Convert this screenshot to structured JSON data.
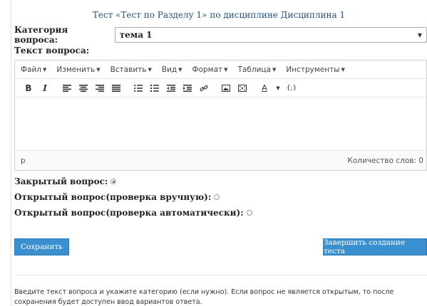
{
  "page": {
    "title": "Тест «Тест по Разделу 1» по дисциплине Дисциплина 1"
  },
  "category": {
    "label": "Категория вопроса:",
    "selected": "тема 1"
  },
  "question_text": {
    "label": "Текст вопроса:"
  },
  "editor": {
    "menus": [
      "Файл",
      "Изменить",
      "Вставить",
      "Вид",
      "Формат",
      "Таблица",
      "Инструменты"
    ],
    "toolbar": {
      "bold": "B",
      "italic": "I",
      "font_color": "A",
      "code": "{;}"
    },
    "status": {
      "path": "p",
      "word_count": "Количество слов: 0"
    }
  },
  "question_type": {
    "closed": "Закрытый вопрос:",
    "open_manual": "Открытый вопрос(проверка вручную):",
    "open_auto": "Открытый вопрос(проверка автоматически):",
    "selected": "closed"
  },
  "buttons": {
    "save": "Сохранить",
    "finish": "Завершить создание теста"
  },
  "help_text": "Введите текст вопроса и укажите категорию (если нужно). Если вопрос не является открытым, то после сохранения будет доступен ввод вариантов ответа.",
  "colors": {
    "accent": "#3a8fcf",
    "title": "#1f4e79"
  }
}
